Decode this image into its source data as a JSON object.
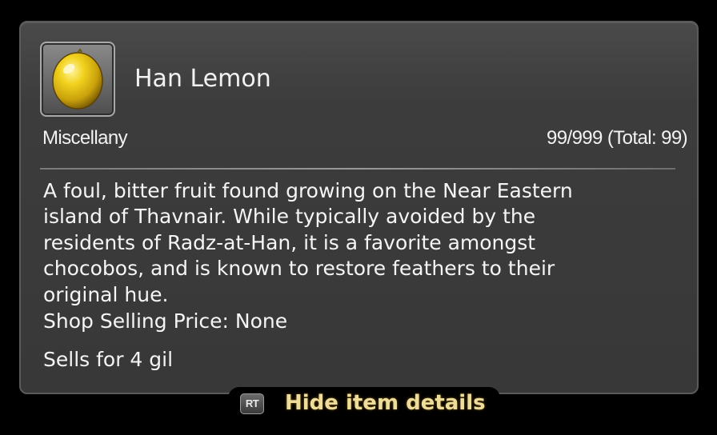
{
  "item": {
    "name": "Han Lemon",
    "icon": "lemon-icon",
    "category": "Miscellany",
    "quantity": "99/999 (Total: 99)"
  },
  "description": {
    "lines": [
      "A foul, bitter fruit found growing on the Near Eastern",
      "island of Thavnair. While typically avoided by the",
      "residents of Radz-at-Han, it is a favorite amongst",
      "chocobos, and is known to restore feathers to their",
      "original hue."
    ]
  },
  "prices": {
    "shop_selling": "Shop Selling Price: None",
    "sells_for": "Sells for 4 gil"
  },
  "hint": {
    "button_label": "RT",
    "action_label": "Hide item details"
  },
  "colors": {
    "panel": "#383838",
    "hint_text": "#eedc9a"
  }
}
